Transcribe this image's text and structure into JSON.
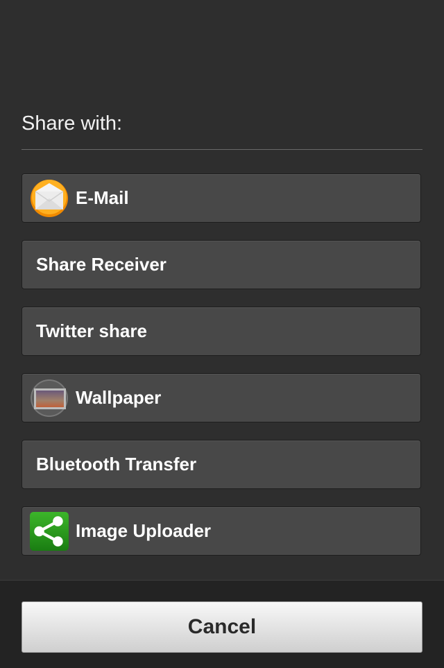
{
  "header": {
    "title": "Share with:"
  },
  "items": [
    {
      "label": "E-Mail",
      "icon": "email-icon"
    },
    {
      "label": "Share Receiver",
      "icon": null
    },
    {
      "label": "Twitter share",
      "icon": null
    },
    {
      "label": "Wallpaper",
      "icon": "wallpaper-icon"
    },
    {
      "label": "Bluetooth Transfer",
      "icon": null
    },
    {
      "label": "Image Uploader",
      "icon": "share-icon"
    }
  ],
  "footer": {
    "cancel_label": "Cancel"
  },
  "colors": {
    "background": "#2e2e2e",
    "item": "#484848",
    "share_green": "#2a9a1e",
    "email_orange": "#f08a00"
  }
}
